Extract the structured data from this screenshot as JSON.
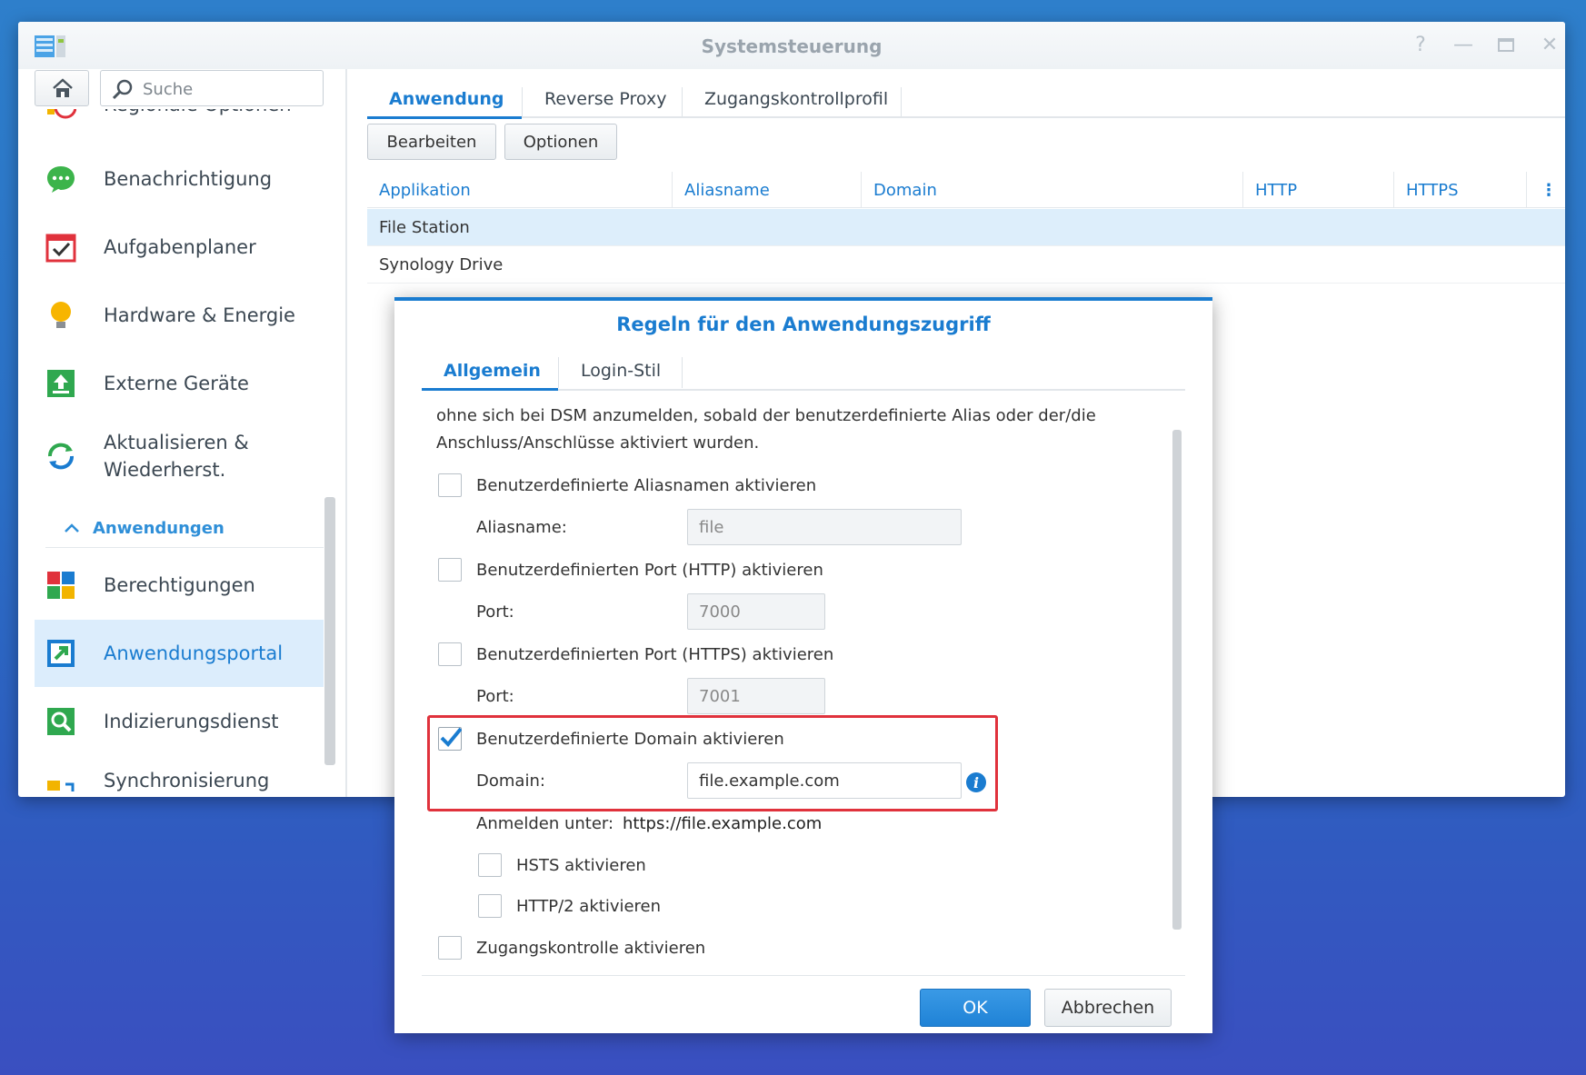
{
  "window": {
    "title": "Systemsteuerung",
    "controls": [
      "help-icon",
      "minimize-icon",
      "maximize-icon",
      "close-icon"
    ]
  },
  "search": {
    "placeholder": "Suche"
  },
  "sidebar": {
    "items": [
      {
        "label": "Regionale Optionen",
        "icon": "regional-options-icon"
      },
      {
        "label": "Benachrichtigung",
        "icon": "notification-icon"
      },
      {
        "label": "Aufgabenplaner",
        "icon": "task-scheduler-icon"
      },
      {
        "label": "Hardware & Energie",
        "icon": "hardware-power-icon"
      },
      {
        "label": "Externe Geräte",
        "icon": "external-devices-icon"
      },
      {
        "label": "Aktualisieren & Wiederherst.",
        "icon": "update-restore-icon"
      }
    ],
    "section_label": "Anwendungen",
    "app_items": [
      {
        "label": "Berechtigungen",
        "icon": "privileges-icon"
      },
      {
        "label": "Anwendungsportal",
        "icon": "application-portal-icon",
        "active": true
      },
      {
        "label": "Indizierungsdienst",
        "icon": "indexing-service-icon"
      },
      {
        "label": "Synchronisierung freigegebener Ordner",
        "icon": "shared-folder-sync-icon"
      }
    ]
  },
  "main": {
    "tabs": [
      {
        "label": "Anwendung",
        "active": true
      },
      {
        "label": "Reverse Proxy"
      },
      {
        "label": "Zugangskontrollprofil"
      }
    ],
    "toolbar": {
      "edit_label": "Bearbeiten",
      "options_label": "Optionen"
    },
    "grid": {
      "columns": [
        "Applikation",
        "Aliasname",
        "Domain",
        "HTTP",
        "HTTPS"
      ],
      "rows": [
        {
          "app": "File Station",
          "selected": true
        },
        {
          "app": "Synology Drive"
        }
      ]
    }
  },
  "dialog": {
    "title": "Regeln für den Anwendungszugriff",
    "tabs": [
      {
        "label": "Allgemein",
        "active": true
      },
      {
        "label": "Login-Stil"
      }
    ],
    "intro_line1": "ohne sich bei DSM anzumelden, sobald der benutzerdefinierte Alias oder der/die",
    "intro_line2": "Anschluss/Anschlüsse aktiviert wurden.",
    "alias_checkbox": "Benutzerdefinierte Aliasnamen aktivieren",
    "alias_label": "Aliasname:",
    "alias_value": "file",
    "http_checkbox": "Benutzerdefinierten Port (HTTP) aktivieren",
    "http_port_label": "Port:",
    "http_port_value": "7000",
    "https_checkbox": "Benutzerdefinierten Port (HTTPS) aktivieren",
    "https_port_label": "Port:",
    "https_port_value": "7001",
    "domain_checkbox": "Benutzerdefinierte Domain aktivieren",
    "domain_checked": true,
    "domain_label": "Domain:",
    "domain_value": "file.example.com",
    "login_at_label": "Anmelden unter:",
    "login_at_url": "https://file.example.com",
    "hsts_checkbox": "HSTS aktivieren",
    "http2_checkbox": "HTTP/2 aktivieren",
    "access_checkbox": "Zugangskontrolle aktivieren",
    "ok_label": "OK",
    "cancel_label": "Abbrechen"
  },
  "colors": {
    "accent": "#1a7cd0",
    "highlight": "#e0323c",
    "selected_row": "#ddeefb",
    "desktop": "#2b6fc6"
  }
}
